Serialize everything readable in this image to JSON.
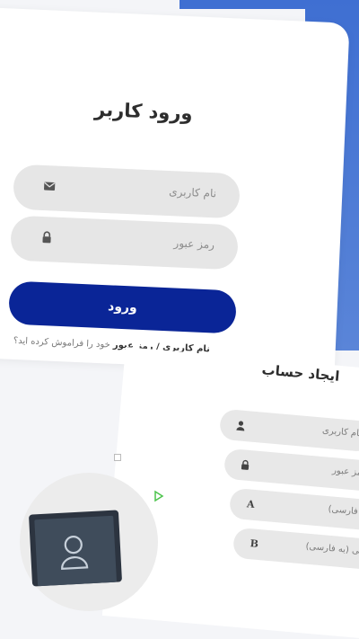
{
  "login": {
    "title": "ورود کاربر",
    "username_placeholder": "نام کاربری",
    "password_placeholder": "رمز عبور",
    "submit_label": "ورود",
    "forgot_bold": "نام کاربری / رمز عبور",
    "forgot_rest": " خود را فراموش کرده اید؟",
    "icons": {
      "username": "envelope-icon",
      "password": "lock-icon"
    }
  },
  "signup": {
    "title": "ایجاد حساب",
    "fields": [
      {
        "label": "نام کاربری",
        "icon": "user-icon"
      },
      {
        "label": "رمز عبور",
        "icon": "lock-icon"
      },
      {
        "label": "(به فارسی)",
        "icon": "A"
      },
      {
        "label": "زندگی (به فارسی)",
        "icon": "B"
      }
    ]
  },
  "colors": {
    "accent": "#0a2597",
    "background_blue": "#3f6fd2",
    "field_bg": "#e6e6e6"
  }
}
